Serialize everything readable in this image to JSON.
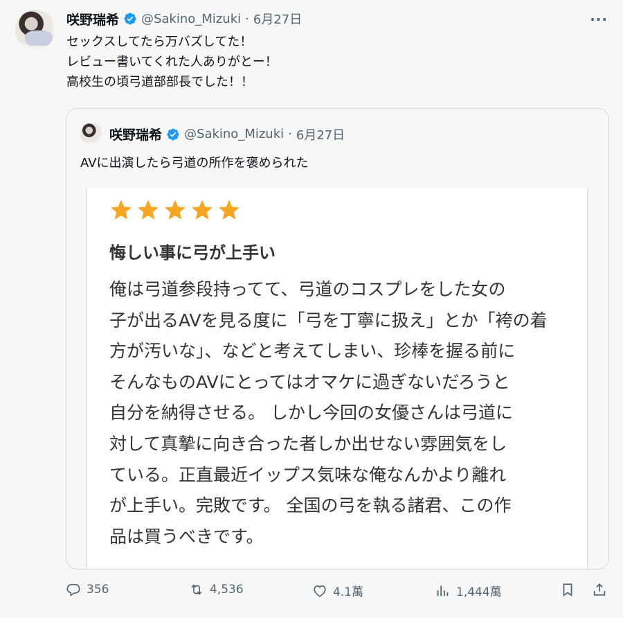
{
  "tweet": {
    "author_name": "咲野瑞希",
    "handle": "@Sakino_Mizuki",
    "separator": "·",
    "date": "6月27日",
    "text": "セックスしてたら万バズしてた！\nレビュー書いてくれた人ありがとー！\n高校生の頃弓道部部長でした！！"
  },
  "quoted_tweet": {
    "author_name": "咲野瑞希",
    "handle": "@Sakino_Mizuki",
    "separator": "·",
    "date": "6月27日",
    "text": "AVに出演したら弓道の所作を褒められた",
    "review": {
      "rating": 5,
      "title": "悔しい事に弓が上手い",
      "lines": [
        "俺は弓道参段持ってて、弓道のコスプレをした女の",
        "子が出るAVを見る度に「弓を丁寧に扱え」とか「袴の着",
        "方が汚いな」、などと考えてしまい、珍棒を握る前に",
        "そんなものAVにとってはオマケに過ぎないだろうと",
        "自分を納得させる。 しかし今回の女優さんは弓道に",
        "対して真摯に向き合った者しか出せない雰囲気をし",
        "ている。正直最近イップス気味な俺なんかより離れ",
        "が上手い。完敗です。 全国の弓を執る諸君、この作",
        "品は買うべきです。"
      ]
    }
  },
  "actions": {
    "replies": "356",
    "reposts": "4,536",
    "likes": "4.1萬",
    "views": "1,444萬"
  },
  "icons": {
    "more": "more-icon",
    "verified": "verified-badge-icon",
    "reply": "reply-icon",
    "repost": "repost-icon",
    "like": "heart-icon",
    "views": "views-icon",
    "bookmark": "bookmark-icon",
    "share": "share-icon"
  },
  "colors": {
    "verified": "#1d9bf0",
    "star": "#f5a623",
    "muted": "#536471"
  }
}
